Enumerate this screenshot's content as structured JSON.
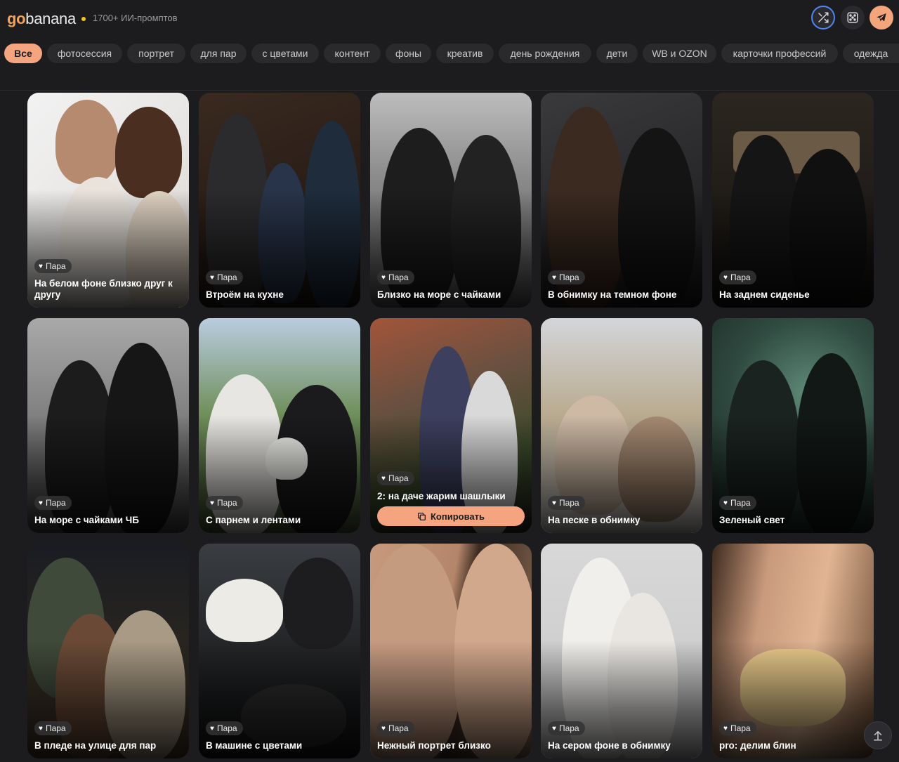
{
  "header": {
    "logo_go": "go",
    "logo_rest": "banana",
    "tagline": "1700+ ИИ-промптов",
    "shuffle_icon": "shuffle-icon",
    "dice_icon": "dice-icon",
    "telegram_icon": "telegram-icon",
    "accent": "#f4a47f"
  },
  "filters": [
    "Все",
    "фотосессия",
    "портрет",
    "для пар",
    "с цветами",
    "контент",
    "фоны",
    "креатив",
    "день рождения",
    "дети",
    "WB и OZON",
    "карточки профессий",
    "одежда"
  ],
  "card_badge": "Пара",
  "cards": [
    {
      "title": "На белом фоне близко друг к другу"
    },
    {
      "title": "Втроём на кухне"
    },
    {
      "title": "Близко на море с чайками"
    },
    {
      "title": "В обнимку на темном фоне"
    },
    {
      "title": "На заднем сиденье"
    },
    {
      "title": "На море с чайками ЧБ"
    },
    {
      "title": "С парнем и лентами"
    },
    {
      "title": "2: на даче жарим шашлыки"
    },
    {
      "title": "На песке в обнимку"
    },
    {
      "title": "Зеленый свет"
    },
    {
      "title": "В пледе на улице для пар"
    },
    {
      "title": "В машине с цветами"
    },
    {
      "title": "Нежный портрет близко"
    },
    {
      "title": "На сером фоне в обнимку"
    },
    {
      "title": "pro: делим блин"
    }
  ],
  "copy_label": "Копировать"
}
